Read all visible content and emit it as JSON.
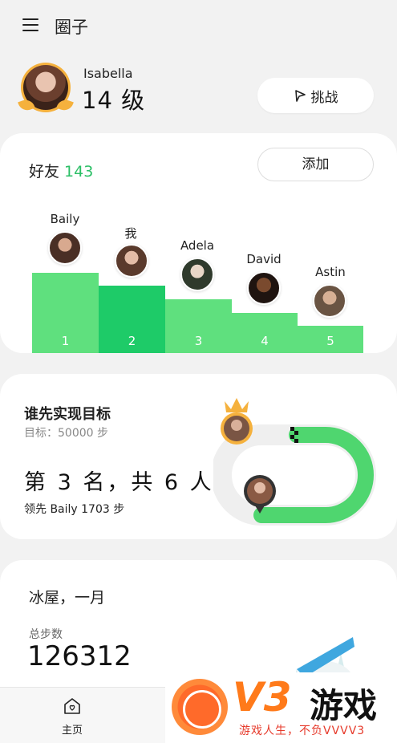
{
  "header": {
    "title": "圈子",
    "menu_icon": "menu-icon"
  },
  "profile": {
    "name": "Isabella",
    "level": "14 级",
    "challenge_label": "挑战",
    "challenge_icon": "flag-icon"
  },
  "friends": {
    "title": "好友",
    "count": "143",
    "add_label": "添加",
    "leaderboard": [
      {
        "rank": "1",
        "name": "Baily"
      },
      {
        "rank": "2",
        "name": "我"
      },
      {
        "rank": "3",
        "name": "Adela"
      },
      {
        "rank": "4",
        "name": "David"
      },
      {
        "rank": "5",
        "name": "Astin"
      }
    ]
  },
  "race": {
    "title": "谁先实现目标",
    "goal": "目标：50000 步",
    "rank_text": "第 3 名，共 6 人",
    "lead_text": "领先 Baily 1703 步"
  },
  "cabin": {
    "title": "冰屋，一月",
    "total_label": "总步数",
    "total_value": "126312"
  },
  "nav": {
    "home_label": "主页",
    "home_icon": "home-icon"
  },
  "watermark": {
    "brand": "V3",
    "name": "游戏",
    "slogan": "游戏人生，不负VVVV3"
  },
  "colors": {
    "accent_green": "#2bbf66",
    "bar_green": "#5fe07e",
    "bar_me": "#1ecb68",
    "crown_gold": "#f5b13d"
  }
}
